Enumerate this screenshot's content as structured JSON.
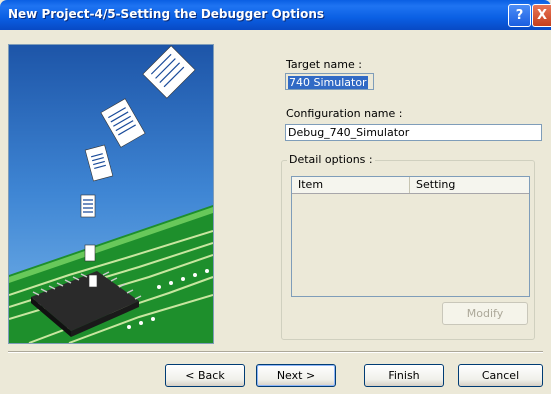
{
  "window": {
    "title": "New Project-4/5-Setting the Debugger Options",
    "help_label": "?",
    "close_label": "X"
  },
  "form": {
    "target_name_label": "Target name :",
    "target_name_value": "740 Simulator",
    "config_name_label": "Configuration name :",
    "config_name_value": "Debug_740_Simulator",
    "detail_options_label": "Detail options :",
    "columns": [
      "Item",
      "Setting"
    ],
    "modify_label": "Modify"
  },
  "buttons": {
    "back": "< Back",
    "next": "Next >",
    "finish": "Finish",
    "cancel": "Cancel"
  }
}
